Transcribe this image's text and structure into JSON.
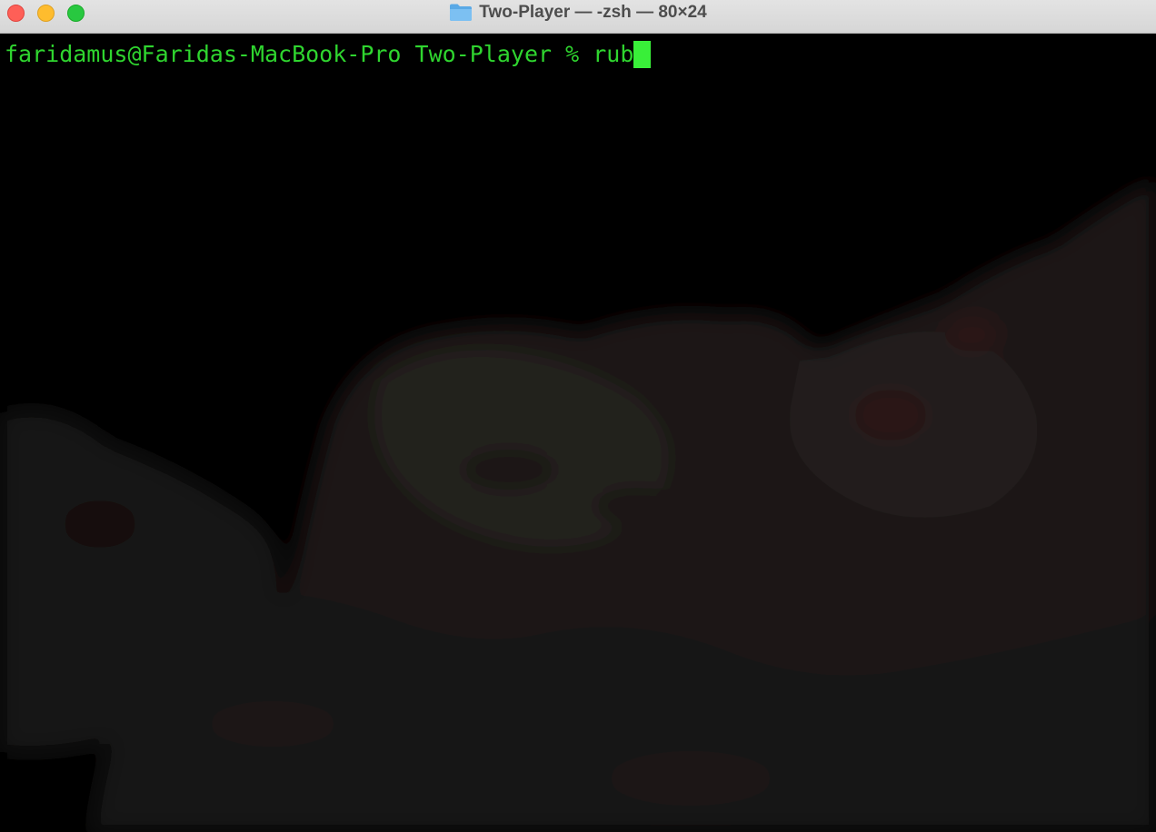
{
  "window": {
    "title": "Two-Player — -zsh — 80×24",
    "title_icon": "folder-icon"
  },
  "traffic_lights": {
    "close": "close-button",
    "minimize": "minimize-button",
    "zoom": "zoom-button"
  },
  "terminal": {
    "prompt": "faridamus@Faridas-MacBook-Pro Two-Player % ",
    "input": "rub",
    "text_color": "#2fd52f",
    "cursor_color": "#39ef39",
    "background_color": "#000000"
  }
}
